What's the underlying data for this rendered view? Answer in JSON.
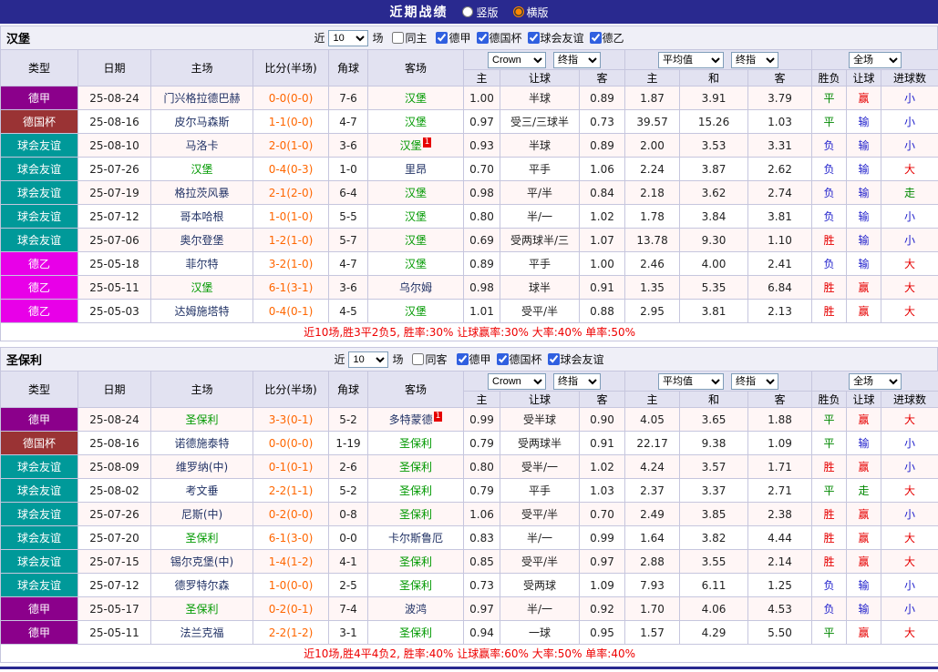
{
  "title_bar": {
    "title": "近期战绩",
    "options": [
      {
        "label": "竖版",
        "selected": false
      },
      {
        "label": "横版",
        "selected": true
      }
    ]
  },
  "table_header": {
    "cols": [
      "类型",
      "日期",
      "主场",
      "比分(半场)",
      "角球",
      "客场"
    ],
    "bookmaker": "Crown",
    "stage": "终指",
    "average": "平均值",
    "scope": "全场",
    "sub": [
      "主",
      "让球",
      "客",
      "主",
      "和",
      "客",
      "胜负",
      "让球",
      "进球数"
    ]
  },
  "colors": {
    "type": {
      "德甲": "#8B008B",
      "德国杯": "#9A3334",
      "球会友谊": "#009999",
      "德乙": "#E800E8"
    },
    "result": {
      "胜": "#E60000",
      "赢": "#E60000",
      "大": "#E60000",
      "平": "#008800",
      "走": "#008800",
      "负": "#2222CC",
      "输": "#2222CC",
      "小": "#2222CC"
    }
  },
  "sections": [
    {
      "team": "汉堡",
      "filter": {
        "prefix": "近",
        "count": "10",
        "suffix": "场",
        "same_label": "同主",
        "same_checked": false,
        "leagues": [
          "德甲",
          "德国杯",
          "球会友谊",
          "德乙"
        ]
      },
      "rows": [
        {
          "type": "德甲",
          "date": "25-08-24",
          "home": "门兴格拉德巴赫",
          "home_self": false,
          "score": "0-0(0-0)",
          "corner": "7-6",
          "away": "汉堡",
          "away_self": true,
          "odds": [
            "1.00",
            "半球",
            "0.89"
          ],
          "avg": [
            "1.87",
            "3.91",
            "3.79"
          ],
          "result": "平",
          "handicap_result": "赢",
          "goals": "小"
        },
        {
          "type": "德国杯",
          "date": "25-08-16",
          "home": "皮尔马森斯",
          "home_self": false,
          "score": "1-1(0-0)",
          "corner": "4-7",
          "away": "汉堡",
          "away_self": true,
          "odds": [
            "0.97",
            "受三/三球半",
            "0.73"
          ],
          "avg": [
            "39.57",
            "15.26",
            "1.03"
          ],
          "result": "平",
          "handicap_result": "输",
          "goals": "小"
        },
        {
          "type": "球会友谊",
          "date": "25-08-10",
          "home": "马洛卡",
          "home_self": false,
          "score": "2-0(1-0)",
          "corner": "3-6",
          "away": "汉堡",
          "away_self": true,
          "away_sup": "1",
          "odds": [
            "0.93",
            "半球",
            "0.89"
          ],
          "avg": [
            "2.00",
            "3.53",
            "3.31"
          ],
          "result": "负",
          "handicap_result": "输",
          "goals": "小"
        },
        {
          "type": "球会友谊",
          "date": "25-07-26",
          "home": "汉堡",
          "home_self": true,
          "score": "0-4(0-3)",
          "corner": "1-0",
          "away": "里昂",
          "away_self": false,
          "odds": [
            "0.70",
            "平手",
            "1.06"
          ],
          "avg": [
            "2.24",
            "3.87",
            "2.62"
          ],
          "result": "负",
          "handicap_result": "输",
          "goals": "大"
        },
        {
          "type": "球会友谊",
          "date": "25-07-19",
          "home": "格拉茨风暴",
          "home_self": false,
          "score": "2-1(2-0)",
          "corner": "6-4",
          "away": "汉堡",
          "away_self": true,
          "odds": [
            "0.98",
            "平/半",
            "0.84"
          ],
          "avg": [
            "2.18",
            "3.62",
            "2.74"
          ],
          "result": "负",
          "handicap_result": "输",
          "goals": "走"
        },
        {
          "type": "球会友谊",
          "date": "25-07-12",
          "home": "哥本哈根",
          "home_self": false,
          "score": "1-0(1-0)",
          "corner": "5-5",
          "away": "汉堡",
          "away_self": true,
          "odds": [
            "0.80",
            "半/一",
            "1.02"
          ],
          "avg": [
            "1.78",
            "3.84",
            "3.81"
          ],
          "result": "负",
          "handicap_result": "输",
          "goals": "小"
        },
        {
          "type": "球会友谊",
          "date": "25-07-06",
          "home": "奥尔登堡",
          "home_self": false,
          "score": "1-2(1-0)",
          "corner": "5-7",
          "away": "汉堡",
          "away_self": true,
          "odds": [
            "0.69",
            "受两球半/三",
            "1.07"
          ],
          "avg": [
            "13.78",
            "9.30",
            "1.10"
          ],
          "result": "胜",
          "handicap_result": "输",
          "goals": "小"
        },
        {
          "type": "德乙",
          "date": "25-05-18",
          "home": "菲尔特",
          "home_self": false,
          "score": "3-2(1-0)",
          "corner": "4-7",
          "away": "汉堡",
          "away_self": true,
          "odds": [
            "0.89",
            "平手",
            "1.00"
          ],
          "avg": [
            "2.46",
            "4.00",
            "2.41"
          ],
          "result": "负",
          "handicap_result": "输",
          "goals": "大"
        },
        {
          "type": "德乙",
          "date": "25-05-11",
          "home": "汉堡",
          "home_self": true,
          "score": "6-1(3-1)",
          "corner": "3-6",
          "away": "乌尔姆",
          "away_self": false,
          "odds": [
            "0.98",
            "球半",
            "0.91"
          ],
          "avg": [
            "1.35",
            "5.35",
            "6.84"
          ],
          "result": "胜",
          "handicap_result": "赢",
          "goals": "大"
        },
        {
          "type": "德乙",
          "date": "25-05-03",
          "home": "达姆施塔特",
          "home_self": false,
          "score": "0-4(0-1)",
          "corner": "4-5",
          "away": "汉堡",
          "away_self": true,
          "odds": [
            "1.01",
            "受平/半",
            "0.88"
          ],
          "avg": [
            "2.95",
            "3.81",
            "2.13"
          ],
          "result": "胜",
          "handicap_result": "赢",
          "goals": "大"
        }
      ],
      "summary": "近10场,胜3平2负5, 胜率:30% 让球赢率:30% 大率:40% 单率:50%"
    },
    {
      "team": "圣保利",
      "filter": {
        "prefix": "近",
        "count": "10",
        "suffix": "场",
        "same_label": "同客",
        "same_checked": false,
        "leagues": [
          "德甲",
          "德国杯",
          "球会友谊"
        ]
      },
      "rows": [
        {
          "type": "德甲",
          "date": "25-08-24",
          "home": "圣保利",
          "home_self": true,
          "score": "3-3(0-1)",
          "corner": "5-2",
          "away": "多特蒙德",
          "away_self": false,
          "away_sup": "1",
          "odds": [
            "0.99",
            "受半球",
            "0.90"
          ],
          "avg": [
            "4.05",
            "3.65",
            "1.88"
          ],
          "result": "平",
          "handicap_result": "赢",
          "goals": "大"
        },
        {
          "type": "德国杯",
          "date": "25-08-16",
          "home": "诺德施泰特",
          "home_self": false,
          "score": "0-0(0-0)",
          "corner": "1-19",
          "away": "圣保利",
          "away_self": true,
          "odds": [
            "0.79",
            "受两球半",
            "0.91"
          ],
          "avg": [
            "22.17",
            "9.38",
            "1.09"
          ],
          "result": "平",
          "handicap_result": "输",
          "goals": "小"
        },
        {
          "type": "球会友谊",
          "date": "25-08-09",
          "home": "维罗纳(中)",
          "home_self": false,
          "score": "0-1(0-1)",
          "corner": "2-6",
          "away": "圣保利",
          "away_self": true,
          "odds": [
            "0.80",
            "受半/一",
            "1.02"
          ],
          "avg": [
            "4.24",
            "3.57",
            "1.71"
          ],
          "result": "胜",
          "handicap_result": "赢",
          "goals": "小"
        },
        {
          "type": "球会友谊",
          "date": "25-08-02",
          "home": "考文垂",
          "home_self": false,
          "score": "2-2(1-1)",
          "corner": "5-2",
          "away": "圣保利",
          "away_self": true,
          "odds": [
            "0.79",
            "平手",
            "1.03"
          ],
          "avg": [
            "2.37",
            "3.37",
            "2.71"
          ],
          "result": "平",
          "handicap_result": "走",
          "goals": "大"
        },
        {
          "type": "球会友谊",
          "date": "25-07-26",
          "home": "尼斯(中)",
          "home_self": false,
          "score": "0-2(0-0)",
          "corner": "0-8",
          "away": "圣保利",
          "away_self": true,
          "odds": [
            "1.06",
            "受平/半",
            "0.70"
          ],
          "avg": [
            "2.49",
            "3.85",
            "2.38"
          ],
          "result": "胜",
          "handicap_result": "赢",
          "goals": "小"
        },
        {
          "type": "球会友谊",
          "date": "25-07-20",
          "home": "圣保利",
          "home_self": true,
          "score": "6-1(3-0)",
          "corner": "0-0",
          "away": "卡尔斯鲁厄",
          "away_self": false,
          "odds": [
            "0.83",
            "半/一",
            "0.99"
          ],
          "avg": [
            "1.64",
            "3.82",
            "4.44"
          ],
          "result": "胜",
          "handicap_result": "赢",
          "goals": "大"
        },
        {
          "type": "球会友谊",
          "date": "25-07-15",
          "home": "锡尔克堡(中)",
          "home_self": false,
          "score": "1-4(1-2)",
          "corner": "4-1",
          "away": "圣保利",
          "away_self": true,
          "odds": [
            "0.85",
            "受平/半",
            "0.97"
          ],
          "avg": [
            "2.88",
            "3.55",
            "2.14"
          ],
          "result": "胜",
          "handicap_result": "赢",
          "goals": "大"
        },
        {
          "type": "球会友谊",
          "date": "25-07-12",
          "home": "德罗特尔森",
          "home_self": false,
          "score": "1-0(0-0)",
          "corner": "2-5",
          "away": "圣保利",
          "away_self": true,
          "odds": [
            "0.73",
            "受两球",
            "1.09"
          ],
          "avg": [
            "7.93",
            "6.11",
            "1.25"
          ],
          "result": "负",
          "handicap_result": "输",
          "goals": "小"
        },
        {
          "type": "德甲",
          "date": "25-05-17",
          "home": "圣保利",
          "home_self": true,
          "score": "0-2(0-1)",
          "corner": "7-4",
          "away": "波鸿",
          "away_self": false,
          "odds": [
            "0.97",
            "半/一",
            "0.92"
          ],
          "avg": [
            "1.70",
            "4.06",
            "4.53"
          ],
          "result": "负",
          "handicap_result": "输",
          "goals": "小"
        },
        {
          "type": "德甲",
          "date": "25-05-11",
          "home": "法兰克福",
          "home_self": false,
          "score": "2-2(1-2)",
          "corner": "3-1",
          "away": "圣保利",
          "away_self": true,
          "odds": [
            "0.94",
            "一球",
            "0.95"
          ],
          "avg": [
            "1.57",
            "4.29",
            "5.50"
          ],
          "result": "平",
          "handicap_result": "赢",
          "goals": "大"
        }
      ],
      "summary": "近10场,胜4平4负2, 胜率:40% 让球赢率:60% 大率:50% 单率:40%"
    }
  ]
}
